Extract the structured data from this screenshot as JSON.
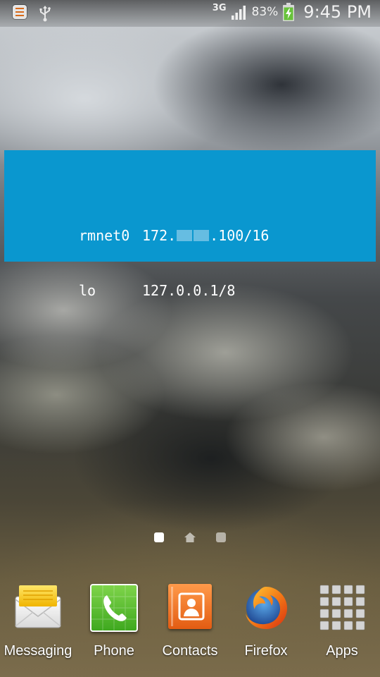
{
  "status_bar": {
    "left_icons": [
      "notification-icon",
      "usb-icon"
    ],
    "network_type": "3G",
    "battery_percent": "83%",
    "clock": "9:45 PM"
  },
  "widget": {
    "rows": [
      {
        "interface": "rmnet0",
        "address_prefix": "172.",
        "address_suffix": ".100/16",
        "masked": true
      },
      {
        "interface": "lo",
        "address": "127.0.0.1/8"
      }
    ],
    "background": "#0a97cf"
  },
  "page_indicator": {
    "pages": 3,
    "active_index": 0,
    "home_index": 1
  },
  "dock": {
    "items": [
      {
        "label": "Messaging",
        "icon": "messaging-icon"
      },
      {
        "label": "Phone",
        "icon": "phone-icon"
      },
      {
        "label": "Contacts",
        "icon": "contacts-icon"
      },
      {
        "label": "Firefox",
        "icon": "firefox-icon"
      },
      {
        "label": "Apps",
        "icon": "apps-grid-icon"
      }
    ]
  }
}
